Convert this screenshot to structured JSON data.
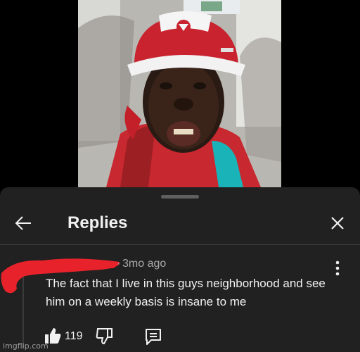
{
  "video": {
    "cap_logo": "logo-icon"
  },
  "sheet": {
    "title": "Replies",
    "back_icon": "arrow-left-icon",
    "close_icon": "close-icon"
  },
  "comment": {
    "timestamp": "3mo ago",
    "bullet": "·",
    "text": "The fact that I live in this guys neighborhood and see him on a weekly basis is insane to me",
    "more_icon": "more-vertical-icon",
    "like_count": "119",
    "like_icon": "thumbs-up-icon",
    "dislike_icon": "thumbs-down-icon",
    "reply_icon": "comment-icon"
  },
  "watermark": "imgflip.com",
  "colors": {
    "panel_bg": "#212121",
    "text_primary": "#f1f1f1",
    "text_secondary": "#aaaaaa",
    "redaction": "#e8222b"
  }
}
